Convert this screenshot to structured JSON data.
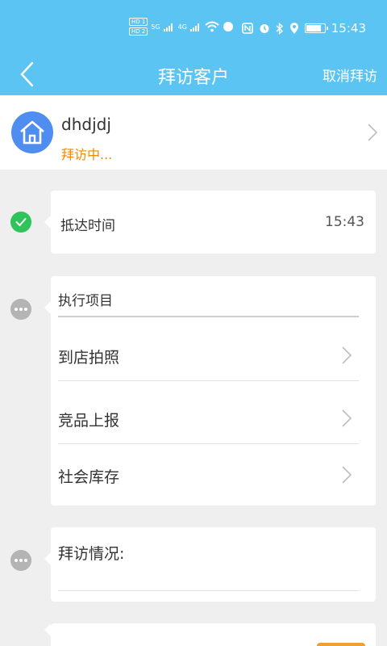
{
  "status_bar": {
    "hd_badges": [
      "HD 1",
      "HD 2"
    ],
    "net1": "5G",
    "net2": "4G",
    "time": "15:43",
    "battery_level": 0.85
  },
  "header": {
    "title": "拜访客户",
    "cancel_label": "取消拜访"
  },
  "customer": {
    "name": "dhdjdj",
    "status": "拜访中..."
  },
  "arrival": {
    "label": "抵达时间",
    "time": "15:43"
  },
  "tasks": {
    "title": "执行项目",
    "items": [
      {
        "label": "到店拍照"
      },
      {
        "label": "竞品上报"
      },
      {
        "label": "社会库存"
      }
    ]
  },
  "notes": {
    "label": "拜访情况:"
  },
  "colors": {
    "header_bg": "#5cc4f2",
    "accent_orange": "#f08a00",
    "success_green": "#2ec45a",
    "avatar_blue": "#4f8df0"
  }
}
